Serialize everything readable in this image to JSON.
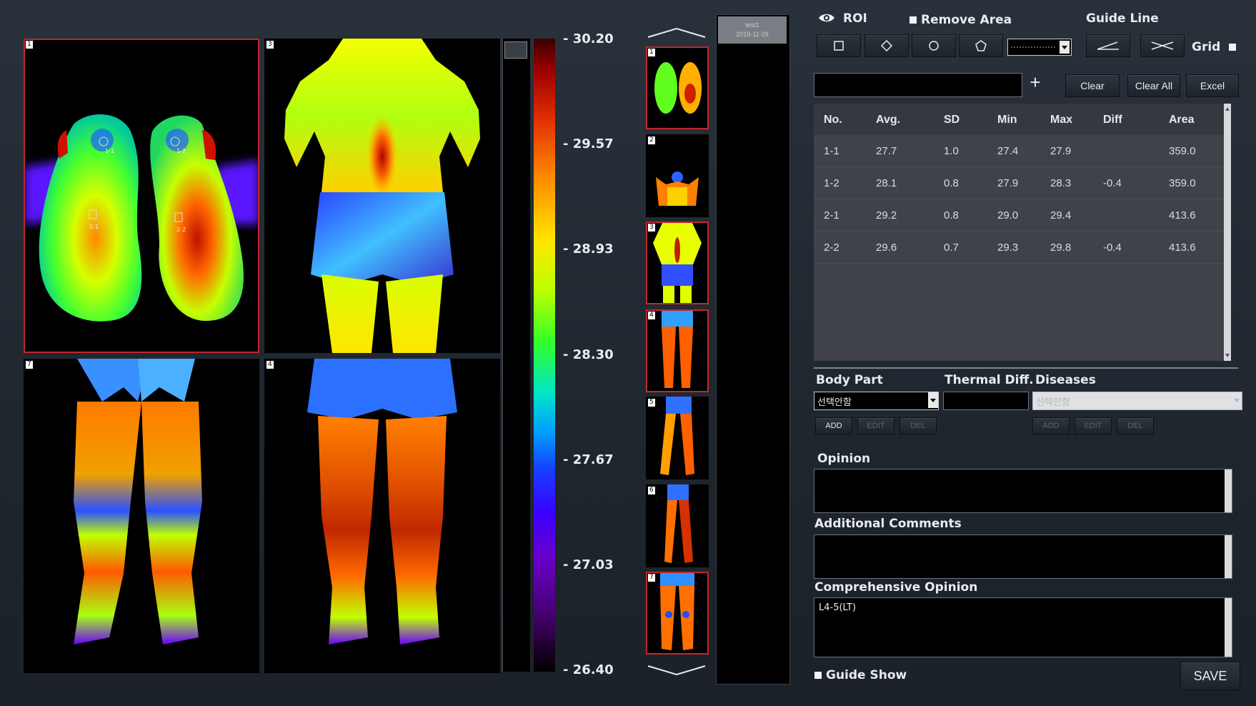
{
  "panels": [
    {
      "number": "1",
      "selected": true,
      "rois": [
        "1-1",
        "1-2",
        "2-1",
        "2-2"
      ]
    },
    {
      "number": "3",
      "selected": false
    },
    {
      "number": "7",
      "selected": false
    },
    {
      "number": "4",
      "selected": false
    }
  ],
  "colorscale": {
    "ticks": [
      "- 30.20",
      "- 29.57",
      "- 28.93",
      "- 28.30",
      "- 27.67",
      "- 27.03",
      "- 26.40"
    ]
  },
  "filmstrip": {
    "thumb_numbers": [
      "1",
      "2",
      "3",
      "4",
      "5",
      "6",
      "7"
    ],
    "selected": [
      "1",
      "3",
      "4",
      "7"
    ],
    "patient_name": "test1",
    "patient_date": "2019-11-29"
  },
  "toolbar": {
    "roi_label": "ROI",
    "remove_area_label": "Remove Area",
    "guide_line_label": "Guide Line",
    "grid_label": "Grid",
    "clear_label": "Clear",
    "clear_all_label": "Clear All",
    "excel_label": "Excel",
    "add_symbol": "+"
  },
  "roi_table": {
    "headers": [
      "No.",
      "Avg.",
      "SD",
      "Min",
      "Max",
      "Diff",
      "Area"
    ],
    "rows": [
      [
        "1-1",
        "27.7",
        "1.0",
        "27.4",
        "27.9",
        "",
        "359.0"
      ],
      [
        "1-2",
        "28.1",
        "0.8",
        "27.9",
        "28.3",
        "-0.4",
        "359.0"
      ],
      [
        "2-1",
        "29.2",
        "0.8",
        "29.0",
        "29.4",
        "",
        "413.6"
      ],
      [
        "2-2",
        "29.6",
        "0.7",
        "29.3",
        "29.8",
        "-0.4",
        "413.6"
      ]
    ]
  },
  "diagnosis": {
    "body_part_label": "Body Part",
    "body_part_value": "선택안함",
    "thermal_diff_label": "Thermal Diff.",
    "diseases_label": "Diseases",
    "diseases_value": "선택안함",
    "add_label": "ADD",
    "edit_label": "EDIT",
    "del_label": "DEL"
  },
  "opinion": {
    "opinion_label": "Opinion",
    "additional_label": "Additional Comments",
    "comprehensive_label": "Comprehensive Opinion",
    "comprehensive_value": "L4-5(LT)"
  },
  "footer": {
    "guide_show_label": "Guide Show",
    "save_label": "SAVE"
  }
}
